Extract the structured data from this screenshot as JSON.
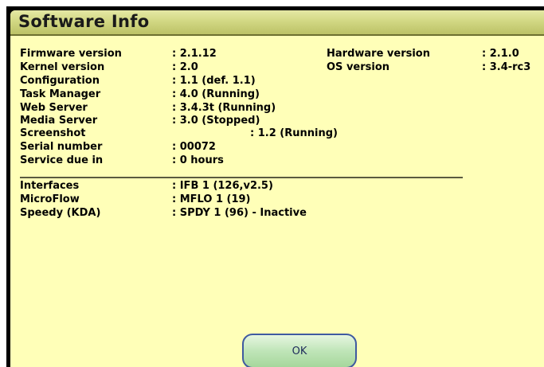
{
  "dialog": {
    "title": "Software Info"
  },
  "info_rows": [
    {
      "label": "Firmware version",
      "value": ": 2.1.12"
    },
    {
      "label": "Kernel version",
      "value": ": 2.0"
    },
    {
      "label": "Configuration",
      "value": ": 1.1 (def. 1.1)"
    },
    {
      "label": "Task Manager",
      "value": ": 4.0 (Running)"
    },
    {
      "label": "Web Server",
      "value": ": 3.4.3t (Running)"
    },
    {
      "label": "Media Server",
      "value": ": 3.0 (Stopped)"
    },
    {
      "label": "Screenshot",
      "value": ": 1.2 (Running)"
    },
    {
      "label": "Serial number",
      "value": ": 00072"
    },
    {
      "label": "Service due in",
      "value": ": 0 hours"
    }
  ],
  "right_rows": [
    {
      "label": "Hardware version",
      "value": ": 2.1.0"
    },
    {
      "label": "OS version",
      "value": ": 3.4-rc3"
    }
  ],
  "interface_rows": [
    {
      "label": "Interfaces",
      "value": ": IFB 1 (126,v2.5)"
    },
    {
      "label": "MicroFlow",
      "value": ": MFLO 1 (19)"
    },
    {
      "label": "Speedy (KDA)",
      "value": ": SPDY 1 (96) - Inactive"
    }
  ],
  "buttons": {
    "ok_label": "OK"
  },
  "colors": {
    "background": "#ffffb8",
    "title_bar": "#d2d884",
    "button_fill": "#bfe5b8",
    "button_border": "#3f5aa0"
  }
}
